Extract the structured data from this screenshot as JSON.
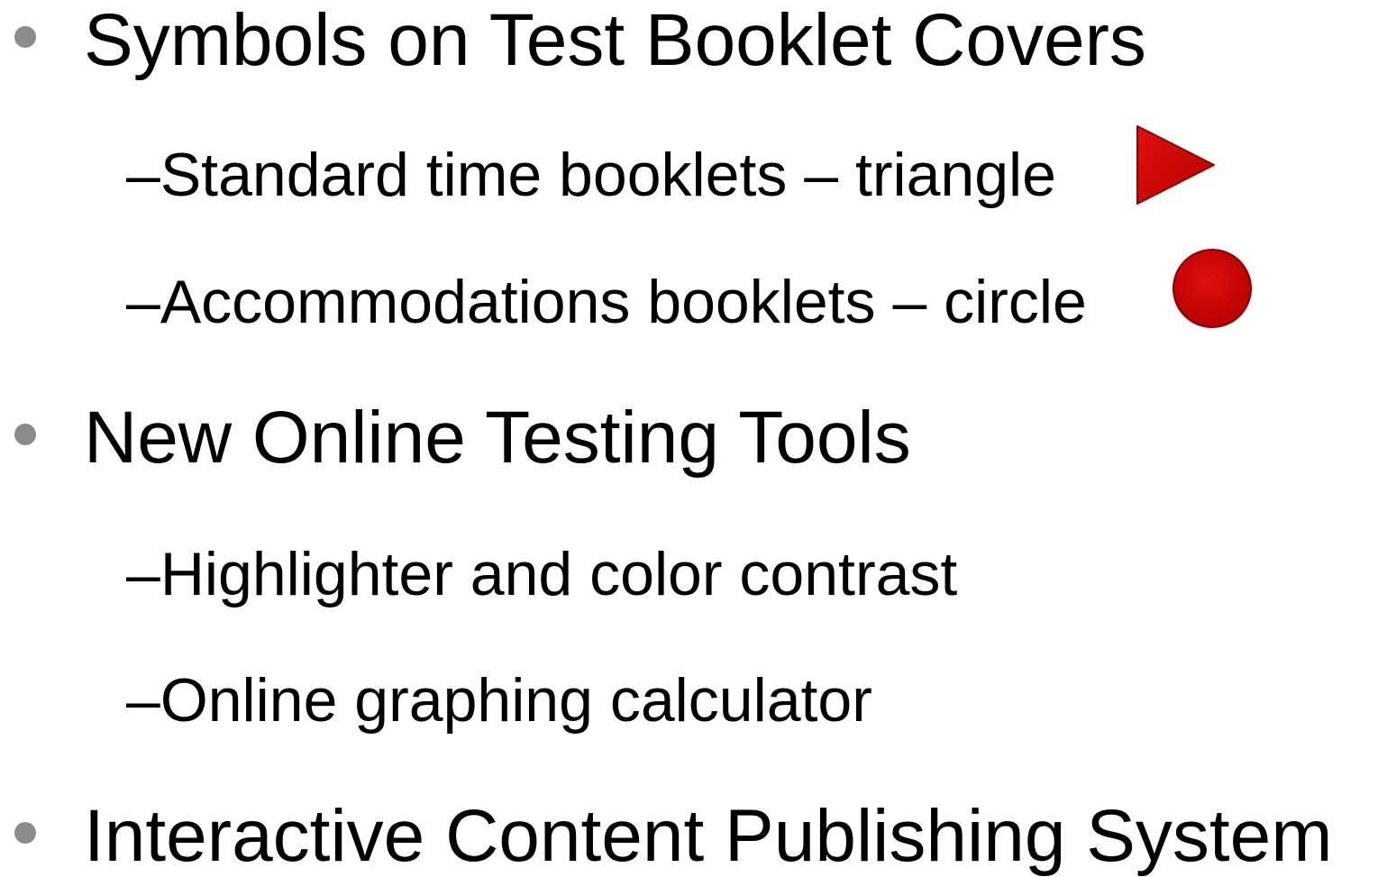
{
  "bullets": [
    {
      "text": "Symbols on Test Booklet Covers",
      "subitems": [
        {
          "dash": "–",
          "text": "Standard time booklets – triangle",
          "icon": "triangle-icon",
          "icon_color": "#cc0000"
        },
        {
          "dash": "–",
          "text": "Accommodations booklets – circle",
          "icon": "circle-icon",
          "icon_color": "#cc0000"
        }
      ]
    },
    {
      "text": "New Online Testing Tools",
      "subitems": [
        {
          "dash": "–",
          "text": "Highlighter and color contrast"
        },
        {
          "dash": "–",
          "text": "Online graphing calculator"
        }
      ]
    },
    {
      "text": "Interactive Content Publishing System",
      "subitems": []
    }
  ],
  "colors": {
    "bullet": "#8c8c8c",
    "shape_fill": "#cc0000",
    "shape_stroke": "#8b0000"
  }
}
